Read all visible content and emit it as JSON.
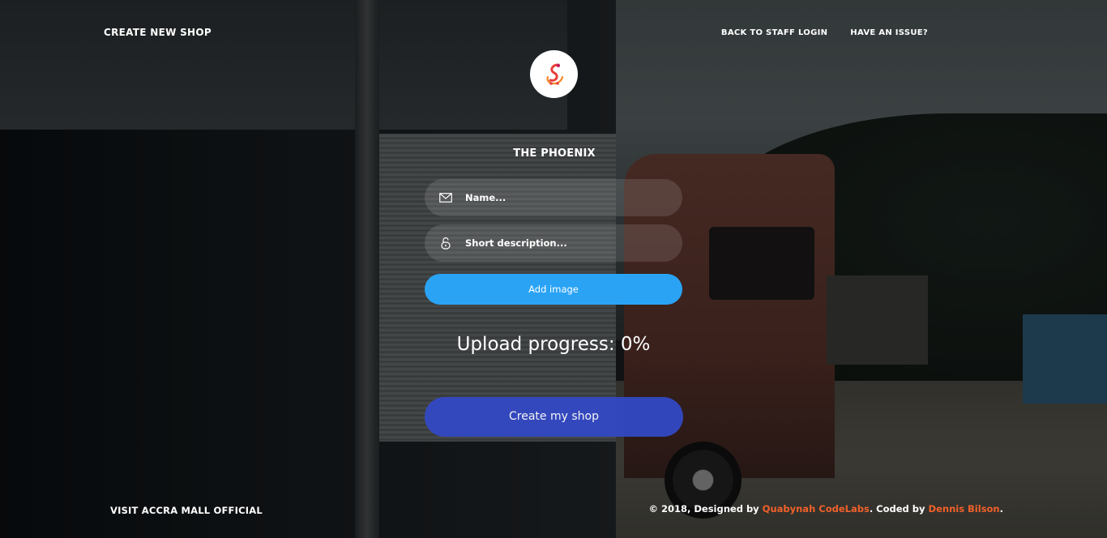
{
  "header": {
    "left_link": "CREATE NEW SHOP",
    "right_links": [
      "BACK TO STAFF LOGIN",
      "HAVE AN ISSUE?"
    ]
  },
  "brand": {
    "name": "THE PHOENIX",
    "logo_icon": "phoenix-logo-icon"
  },
  "form": {
    "name_placeholder": "Name...",
    "description_placeholder": "Short description...",
    "add_image_label": "Add image",
    "upload_label": "Upload progress: ",
    "upload_value": "0%",
    "upload_progress": 0,
    "create_label": "Create my shop"
  },
  "footer": {
    "left": "VISIT ACCRA MALL OFFICIAL",
    "copyright_prefix": "© 2018, Designed by ",
    "designer": "Quabynah CodeLabs",
    "coded_by_text": ". Coded by ",
    "coder": "Dennis Bilson",
    "suffix": "."
  },
  "colors": {
    "accent_blue": "#2aa3f5",
    "button_indigo": "#3349c4",
    "link_orange": "#f0612a"
  }
}
